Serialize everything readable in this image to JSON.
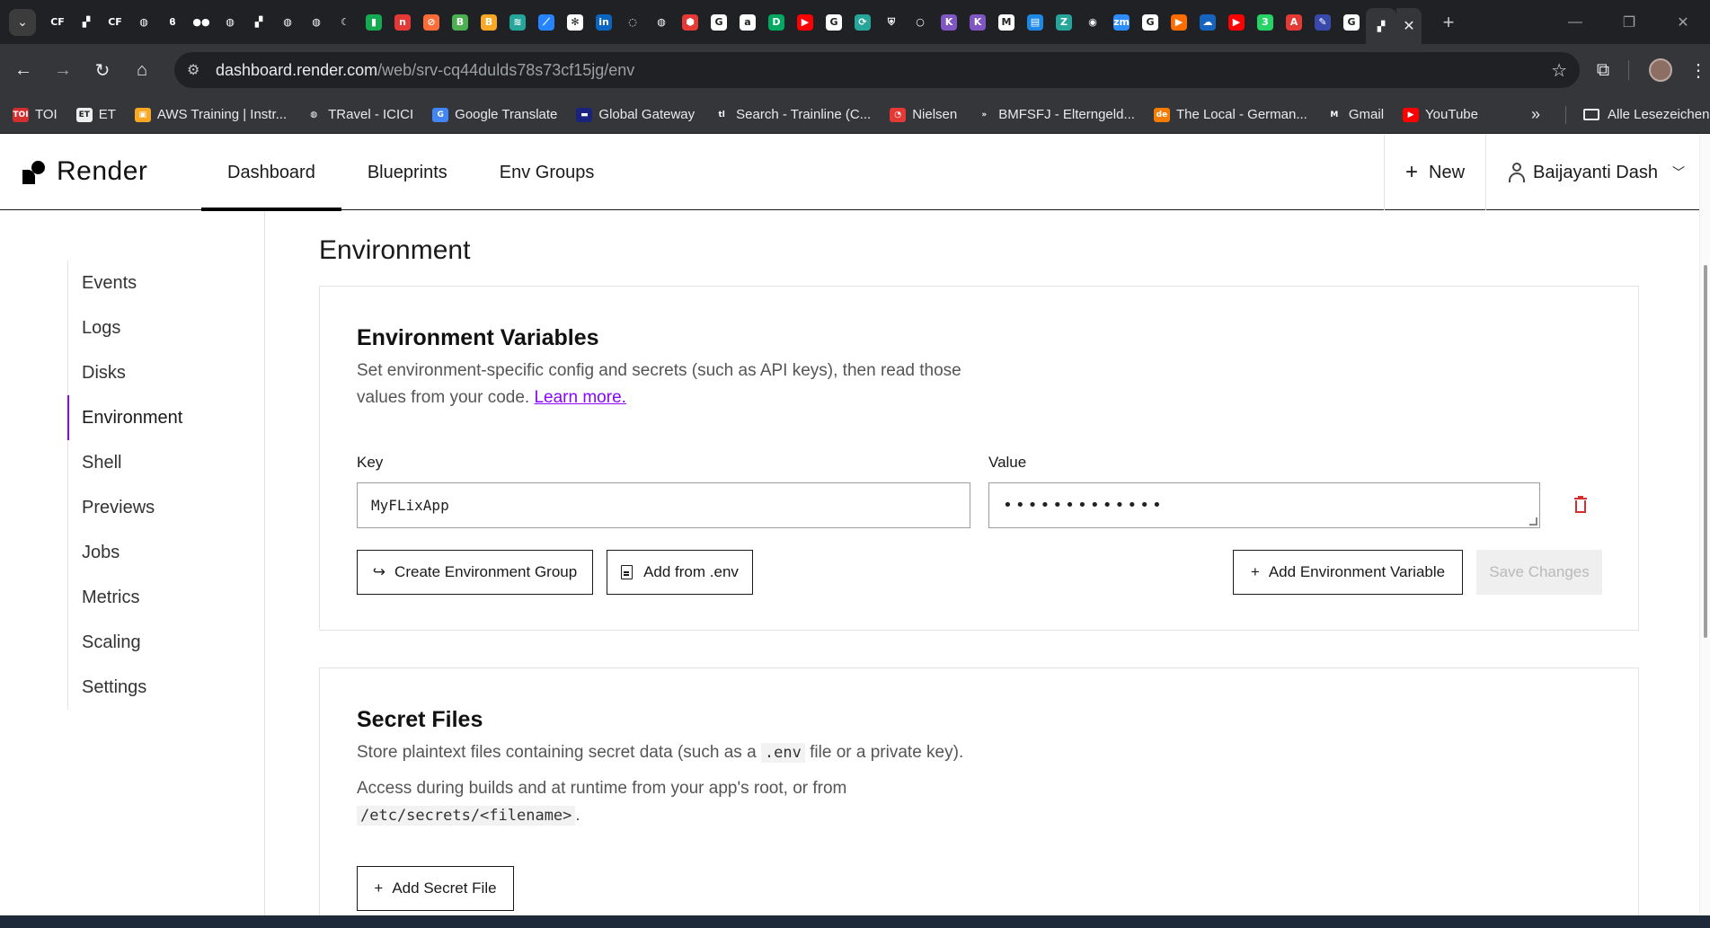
{
  "browser": {
    "tabs": [
      {
        "icon": "cf-icon",
        "glyph": "CF",
        "bg": "#202124",
        "active": false
      },
      {
        "icon": "render-icon",
        "glyph": "▞",
        "bg": "#202124",
        "active": false
      },
      {
        "icon": "cf-icon",
        "glyph": "CF",
        "bg": "#202124",
        "active": false
      },
      {
        "icon": "globe-icon",
        "glyph": "◍",
        "bg": "#202124",
        "active": false
      },
      {
        "icon": "bolt-icon",
        "glyph": "ϐ",
        "bg": "#202124",
        "active": false
      },
      {
        "icon": "medium-icon",
        "glyph": "●●",
        "bg": "#202124",
        "active": false
      },
      {
        "icon": "globe-icon",
        "glyph": "◍",
        "bg": "#202124",
        "active": false
      },
      {
        "icon": "render-icon",
        "glyph": "▞",
        "bg": "#202124",
        "active": false
      },
      {
        "icon": "globe-icon",
        "glyph": "◍",
        "bg": "#202124",
        "active": false
      },
      {
        "icon": "globe-icon",
        "glyph": "◍",
        "bg": "#202124",
        "active": false
      },
      {
        "icon": "moon-icon",
        "glyph": "☾",
        "bg": "#202124",
        "active": false
      },
      {
        "icon": "mongodb-icon",
        "glyph": "▮",
        "bg": "#13aa52",
        "active": false
      },
      {
        "icon": "n-icon",
        "glyph": "n",
        "bg": "#e53935",
        "active": false
      },
      {
        "icon": "postman-icon",
        "glyph": "⊘",
        "bg": "#ff6c37",
        "active": false
      },
      {
        "icon": "b-icon",
        "glyph": "B",
        "bg": "#4caf50",
        "active": false
      },
      {
        "icon": "b-icon",
        "glyph": "B",
        "bg": "#f9a825",
        "active": false
      },
      {
        "icon": "stack-icon",
        "glyph": "≋",
        "bg": "#26a69a",
        "active": false
      },
      {
        "icon": "jira-icon",
        "glyph": "⟋",
        "bg": "#2684ff",
        "active": false
      },
      {
        "icon": "openai-icon",
        "glyph": "✻",
        "bg": "#ffffff",
        "active": false
      },
      {
        "icon": "linkedin-icon",
        "glyph": "in",
        "bg": "#0a66c2",
        "active": false
      },
      {
        "icon": "loader-icon",
        "glyph": "◌",
        "bg": "#202124",
        "active": false
      },
      {
        "icon": "globe-icon",
        "glyph": "◍",
        "bg": "#202124",
        "active": false
      },
      {
        "icon": "hex-icon",
        "glyph": "⬢",
        "bg": "#e53935",
        "active": false
      },
      {
        "icon": "google-icon",
        "glyph": "G",
        "bg": "#ffffff",
        "active": false
      },
      {
        "icon": "amazon-icon",
        "glyph": "a",
        "bg": "#ffffff",
        "active": false
      },
      {
        "icon": "d-icon",
        "glyph": "D",
        "bg": "#00a862",
        "active": false
      },
      {
        "icon": "youtube-icon",
        "glyph": "▶",
        "bg": "#ff0000",
        "active": false
      },
      {
        "icon": "google-icon",
        "glyph": "G",
        "bg": "#ffffff",
        "active": false
      },
      {
        "icon": "sync-icon",
        "glyph": "⟳",
        "bg": "#26a69a",
        "active": false
      },
      {
        "icon": "shield-icon",
        "glyph": "⛨",
        "bg": "#202124",
        "active": false
      },
      {
        "icon": "circle-icon",
        "glyph": "○",
        "bg": "#202124",
        "active": false
      },
      {
        "icon": "k-icon",
        "glyph": "K",
        "bg": "#7e57c2",
        "active": false
      },
      {
        "icon": "k-icon",
        "glyph": "K",
        "bg": "#7e57c2",
        "active": false
      },
      {
        "icon": "gmail-icon",
        "glyph": "M",
        "bg": "#ffffff",
        "active": false
      },
      {
        "icon": "book-icon",
        "glyph": "▤",
        "bg": "#1e88e5",
        "active": false
      },
      {
        "icon": "z-icon",
        "glyph": "Z",
        "bg": "#26a69a",
        "active": false
      },
      {
        "icon": "github-icon",
        "glyph": "◉",
        "bg": "#202124",
        "active": false
      },
      {
        "icon": "zoom-icon",
        "glyph": "zm",
        "bg": "#2d8cff",
        "active": false
      },
      {
        "icon": "google-icon",
        "glyph": "G",
        "bg": "#ffffff",
        "active": false
      },
      {
        "icon": "play-icon",
        "glyph": "▶",
        "bg": "#ff6d00",
        "active": false
      },
      {
        "icon": "cloud-icon",
        "glyph": "☁",
        "bg": "#1565c0",
        "active": false
      },
      {
        "icon": "youtube-icon",
        "glyph": "▶",
        "bg": "#ff0000",
        "active": false
      },
      {
        "icon": "whatsapp-icon",
        "glyph": "3",
        "bg": "#25d366",
        "active": false
      },
      {
        "icon": "adobe-icon",
        "glyph": "A",
        "bg": "#e53935",
        "active": false
      },
      {
        "icon": "pen-icon",
        "glyph": "✎",
        "bg": "#3949ab",
        "active": false
      },
      {
        "icon": "google-icon",
        "glyph": "G",
        "bg": "#ffffff",
        "active": false
      },
      {
        "icon": "render-icon",
        "glyph": "▞",
        "bg": "#35363a",
        "active": true
      }
    ],
    "url_host": "dashboard.render.com",
    "url_path": "/web/srv-cq44dulds78s73cf15jg/env",
    "bookmarks": [
      {
        "label": "TOI",
        "glyph": "TOI",
        "bg": "#d32f2f"
      },
      {
        "label": "ET",
        "glyph": "ET",
        "bg": "#eeeeee"
      },
      {
        "label": "AWS Training | Instr...",
        "glyph": "▣",
        "bg": "#f9a825"
      },
      {
        "label": "TRavel - ICICI",
        "glyph": "◍",
        "bg": "#35363a"
      },
      {
        "label": "Google Translate",
        "glyph": "G",
        "bg": "#4285f4"
      },
      {
        "label": "Global Gateway",
        "glyph": "▬",
        "bg": "#1a237e"
      },
      {
        "label": "Search - Trainline (C...",
        "glyph": "tl",
        "bg": "#35363a"
      },
      {
        "label": "Nielsen",
        "glyph": "◔",
        "bg": "#e53935"
      },
      {
        "label": "BMFSFJ - Elterngeld...",
        "glyph": "»",
        "bg": "#35363a"
      },
      {
        "label": "The Local - German...",
        "glyph": "de",
        "bg": "#f57c00"
      },
      {
        "label": "Gmail",
        "glyph": "M",
        "bg": "#35363a"
      },
      {
        "label": "YouTube",
        "glyph": "▶",
        "bg": "#ff0000"
      }
    ],
    "bookmarks_folder": "Alle Lesezeichen"
  },
  "header": {
    "logo_text": "Render",
    "nav": [
      "Dashboard",
      "Blueprints",
      "Env Groups"
    ],
    "new_label": "New",
    "user_name": "Baijayanti Dash"
  },
  "sidebar": {
    "items": [
      "Events",
      "Logs",
      "Disks",
      "Environment",
      "Shell",
      "Previews",
      "Jobs",
      "Metrics",
      "Scaling",
      "Settings"
    ],
    "active": "Environment"
  },
  "page": {
    "title": "Environment"
  },
  "env_vars": {
    "title": "Environment Variables",
    "desc_line1": "Set environment-specific config and secrets (such as API keys), then read those",
    "desc_line2": "values from your code.",
    "learn_more": "Learn more.",
    "key_label": "Key",
    "value_label": "Value",
    "key_value": "MyFLixApp",
    "value_masked": "•••••••••••••",
    "create_group_label": "Create Environment Group",
    "add_from_env_label": "Add from .env",
    "add_var_label": "Add Environment Variable",
    "save_label": "Save Changes"
  },
  "secret_files": {
    "title": "Secret Files",
    "desc1_pre": "Store plaintext files containing secret data (such as a",
    "desc1_code": ".env",
    "desc1_post": "file or a private key).",
    "desc2_pre": "Access during builds and at runtime from your app's root, or from",
    "desc2_code": "/etc/secrets/<filename>",
    "desc2_post": ".",
    "add_label": "Add Secret File"
  }
}
